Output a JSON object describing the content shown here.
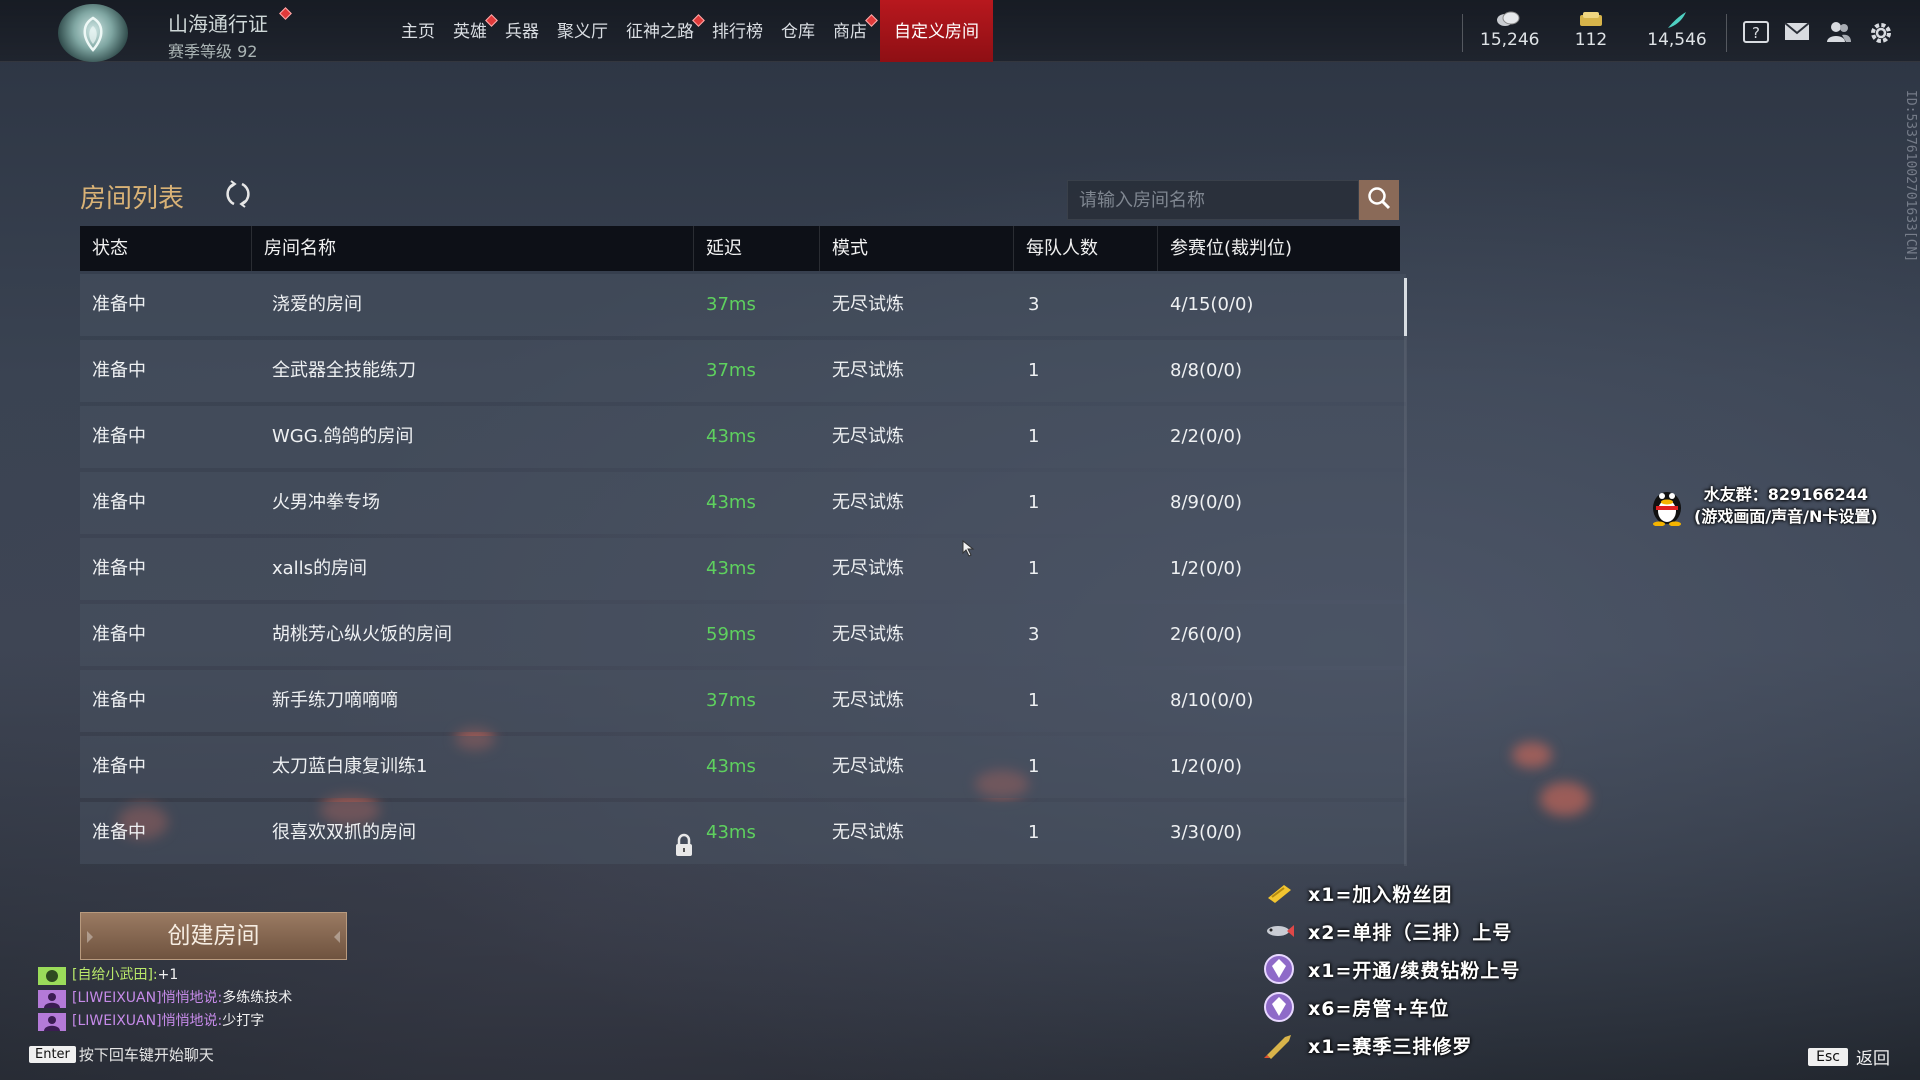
{
  "topbar": {
    "pass_title": "山海通行证",
    "season_level": "赛季等级 92",
    "nav": [
      {
        "label": "主页",
        "badge": false,
        "active": false
      },
      {
        "label": "英雄",
        "badge": true,
        "active": false
      },
      {
        "label": "兵器",
        "badge": false,
        "active": false
      },
      {
        "label": "聚义厅",
        "badge": false,
        "active": false
      },
      {
        "label": "征神之路",
        "badge": true,
        "active": false
      },
      {
        "label": "排行榜",
        "badge": false,
        "active": false
      },
      {
        "label": "仓库",
        "badge": false,
        "active": false
      },
      {
        "label": "商店",
        "badge": true,
        "active": false
      },
      {
        "label": "自定义房间",
        "badge": false,
        "active": true
      }
    ],
    "currencies": [
      {
        "icon": "coin-icon",
        "value": "15,246"
      },
      {
        "icon": "gold-ticket-icon",
        "value": "112"
      },
      {
        "icon": "feather-icon",
        "value": "14,546"
      }
    ],
    "icons": [
      "help-icon",
      "mail-icon",
      "friends-icon",
      "settings-icon"
    ]
  },
  "side_id": "ID:533761002701633[CN]",
  "room_list": {
    "title": "房间列表",
    "search_placeholder": "请输入房间名称",
    "columns": [
      "状态",
      "房间名称",
      "延迟",
      "模式",
      "每队人数",
      "参赛位(裁判位)"
    ],
    "rows": [
      {
        "status": "准备中",
        "name": "浇爱的房间",
        "ping": "37ms",
        "mode": "无尽试炼",
        "team_size": "3",
        "slots": "4/15(0/0)",
        "locked": false
      },
      {
        "status": "准备中",
        "name": "全武器全技能练刀",
        "ping": "37ms",
        "mode": "无尽试炼",
        "team_size": "1",
        "slots": "8/8(0/0)",
        "locked": false
      },
      {
        "status": "准备中",
        "name": "WGG.鸽鸽的房间",
        "ping": "43ms",
        "mode": "无尽试炼",
        "team_size": "1",
        "slots": "2/2(0/0)",
        "locked": false
      },
      {
        "status": "准备中",
        "name": "火男冲拳专场",
        "ping": "43ms",
        "mode": "无尽试炼",
        "team_size": "1",
        "slots": "8/9(0/0)",
        "locked": false
      },
      {
        "status": "准备中",
        "name": "xalls的房间",
        "ping": "43ms",
        "mode": "无尽试炼",
        "team_size": "1",
        "slots": "1/2(0/0)",
        "locked": false
      },
      {
        "status": "准备中",
        "name": "胡桃芳心纵火饭的房间",
        "ping": "59ms",
        "mode": "无尽试炼",
        "team_size": "3",
        "slots": "2/6(0/0)",
        "locked": false
      },
      {
        "status": "准备中",
        "name": "新手练刀嘀嘀嘀",
        "ping": "37ms",
        "mode": "无尽试炼",
        "team_size": "1",
        "slots": "8/10(0/0)",
        "locked": false
      },
      {
        "status": "准备中",
        "name": "太刀蓝白康复训练1",
        "ping": "43ms",
        "mode": "无尽试炼",
        "team_size": "1",
        "slots": "1/2(0/0)",
        "locked": false
      },
      {
        "status": "准备中",
        "name": "很喜欢双抓的房间",
        "ping": "43ms",
        "mode": "无尽试炼",
        "team_size": "1",
        "slots": "3/3(0/0)",
        "locked": true
      }
    ]
  },
  "create_button": "创建房间",
  "chat": [
    {
      "name": "[自给小武田]:",
      "msg": "+1",
      "color": "green"
    },
    {
      "name": "[LIWEIXUAN]悄悄地说:",
      "msg": "多练练技术",
      "color": "purple"
    },
    {
      "name": "[LIWEIXUAN]悄悄地说:",
      "msg": "少打字",
      "color": "purple"
    }
  ],
  "enter_hint": {
    "key": "Enter",
    "text": "按下回车键开始聊天"
  },
  "esc_hint": {
    "key": "Esc",
    "text": "返回"
  },
  "overlay": {
    "qq_line1": "水友群：829166244",
    "qq_line2": "(游戏画面/声音/N卡设置)",
    "perks": [
      {
        "icon": "gold-ticket-icon",
        "text": "x1=加入粉丝团"
      },
      {
        "icon": "fish-icon",
        "text": "x2=单排（三排）上号"
      },
      {
        "icon": "diamond-badge-icon",
        "text": "x1=开通/续费钻粉上号"
      },
      {
        "icon": "diamond-badge-icon",
        "text": "x6=房管+车位"
      },
      {
        "icon": "rocket-icon",
        "text": "x1=赛季三排修罗"
      }
    ]
  }
}
